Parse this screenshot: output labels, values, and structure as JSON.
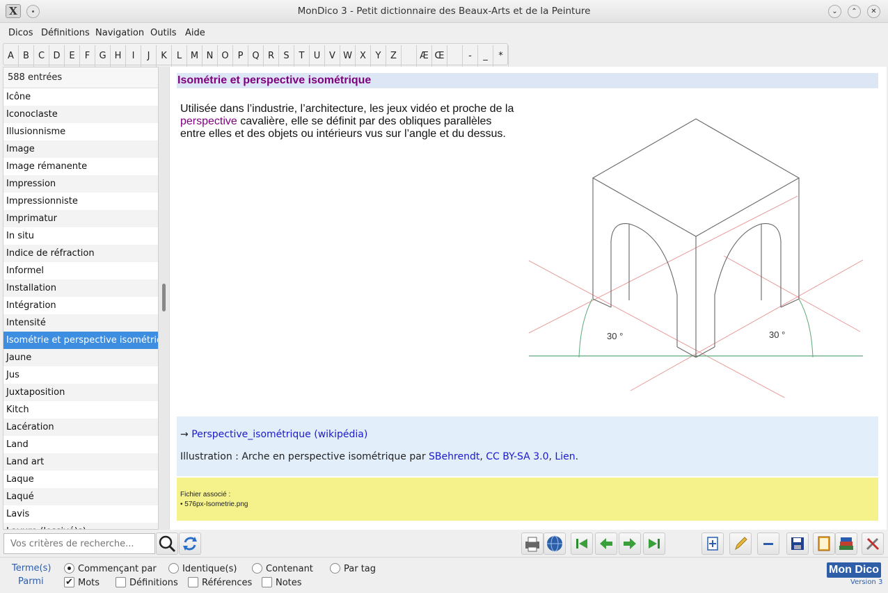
{
  "window": {
    "title": "MonDico 3 - Petit dictionnaire des Beaux-Arts et de la Peinture"
  },
  "menu": [
    "Dicos",
    "Définitions",
    "Navigation",
    "Outils",
    "Aide"
  ],
  "letters": [
    "A",
    "B",
    "C",
    "D",
    "E",
    "F",
    "G",
    "H",
    "I",
    "J",
    "K",
    "L",
    "M",
    "N",
    "O",
    "P",
    "Q",
    "R",
    "S",
    "T",
    "U",
    "V",
    "W",
    "X",
    "Y",
    "Z",
    " ",
    "Æ",
    "Œ",
    " ",
    "-",
    "_",
    "*"
  ],
  "list": {
    "count": "588 entrées",
    "items": [
      "Icône",
      "Iconoclaste",
      "Illusionnisme",
      "Image",
      "Image rémanente",
      "Impression",
      "Impressionniste",
      "Imprimatur",
      "In situ",
      "Indice de réfraction",
      "Informel",
      "Installation",
      "Intégration",
      "Intensité",
      "Isométrie et perspective isométrique",
      "Jaune",
      "Jus",
      "Juxtaposition",
      "Kitch",
      "Lacération",
      "Land",
      "Land art",
      "Laque",
      "Laqué",
      "Lavis",
      "Lavure (lessivé)s)"
    ],
    "selected_index": 14
  },
  "definition": {
    "title": "Isométrie et perspective isométrique",
    "text_before": "Utilisée dans l’industrie, l’architecture, les jeux vidéo et proche de la ",
    "link_word": "perspective",
    "text_after": " cavalière, elle se définit par des obliques parallèles entre elles et des objets ou intérieurs vus sur l’angle et du dessus.",
    "angle_left": "30 °",
    "angle_right": "30 °"
  },
  "links": {
    "arrow": "→ ",
    "wiki_link": "Perspective_isométrique (wikipédia)",
    "illus_prefix": "Illustration : Arche en perspective isométrique par ",
    "author": "SBehrendt",
    "sep1": ", ",
    "license": "CC BY-SA 3.0",
    "sep2": ", ",
    "source": "Lien",
    "end": "."
  },
  "file": {
    "label": "Fichier associé :",
    "name": "• 576px-Isometrie.png"
  },
  "search": {
    "placeholder": "Vos critères de recherche..."
  },
  "options": {
    "terms_label": "Terme(s)",
    "among_label": "Parmi",
    "radios": [
      "Commençant par",
      "Identique(s)",
      "Contenant",
      "Par tag"
    ],
    "radio_selected": 0,
    "checks": [
      "Mots",
      "Définitions",
      "Références",
      "Notes"
    ],
    "checks_state": [
      true,
      false,
      false,
      false
    ]
  },
  "logo": {
    "name": "Mon Dico",
    "version": "Version 3"
  },
  "colors": {
    "selection": "#3d8ee0",
    "title_color": "#800080",
    "link_color": "#1a1acc",
    "file_bg": "#f5f28c"
  }
}
